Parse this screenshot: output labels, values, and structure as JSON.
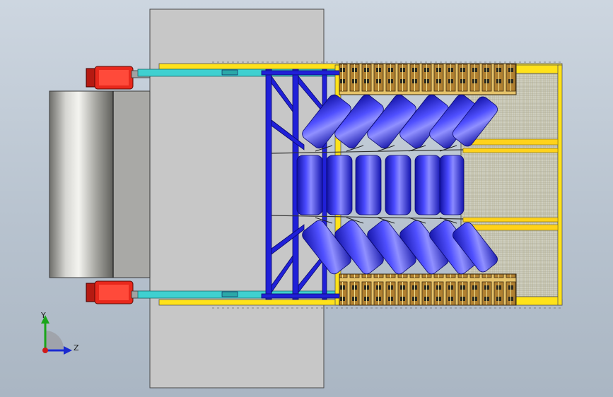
{
  "view": {
    "background_colors": [
      "#cdd6e0",
      "#aab6c3"
    ],
    "colors": {
      "plate": "#c8c8c8",
      "drum": "#b7b7b4",
      "bearing": "#e0261b",
      "frame_yellow": "#ffe21a",
      "frame_blue": "#2020d8",
      "roller_blue": "#2a2ae8",
      "cyan": "#3fd0d0",
      "mesh": "#c9c9b8"
    }
  },
  "triad": {
    "y_label": "Y",
    "z_label": "Z",
    "icons": [
      "y-axis-arrow-icon",
      "z-axis-arrow-icon",
      "x-axis-dot-icon"
    ]
  }
}
